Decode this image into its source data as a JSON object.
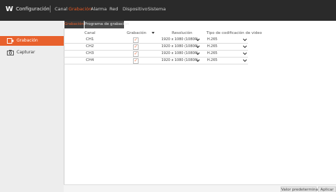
{
  "header": {
    "logo": "W",
    "title": "Configuración",
    "nav": [
      "Canal",
      "Grabación",
      "Alarma",
      "Red",
      "Dispositivo",
      "Sistema"
    ],
    "active_nav": "Grabación"
  },
  "sidebar": {
    "items": [
      {
        "label": "Grabación",
        "icon": "record-icon",
        "active": true
      },
      {
        "label": "Capturar",
        "icon": "camera-icon",
        "active": false
      }
    ]
  },
  "tabs": [
    {
      "label": "Grabación",
      "active": true
    },
    {
      "label": "Programa de grabación",
      "active": false
    }
  ],
  "table": {
    "headers": [
      "Canal",
      "Grabación",
      "Resolución",
      "Tipo de codificación de video"
    ],
    "rows": [
      {
        "channel": "CH1",
        "recording": true,
        "resolution": "1920 x 1080 (1080P)",
        "encoding": "H.265"
      },
      {
        "channel": "CH2",
        "recording": true,
        "resolution": "1920 x 1080 (1080P)",
        "encoding": "H.265"
      },
      {
        "channel": "CH3",
        "recording": true,
        "resolution": "1920 x 1080 (1080P)",
        "encoding": "H.265"
      },
      {
        "channel": "CH4",
        "recording": true,
        "resolution": "1920 x 1080 (1080P)",
        "encoding": "H.265"
      }
    ]
  },
  "footer": {
    "default_label": "Valor predeterminado",
    "apply_label": "Aplicar"
  },
  "colors": {
    "accent": "#e8612c",
    "topbar": "#2a2a2a",
    "sidebar": "#ededed"
  }
}
